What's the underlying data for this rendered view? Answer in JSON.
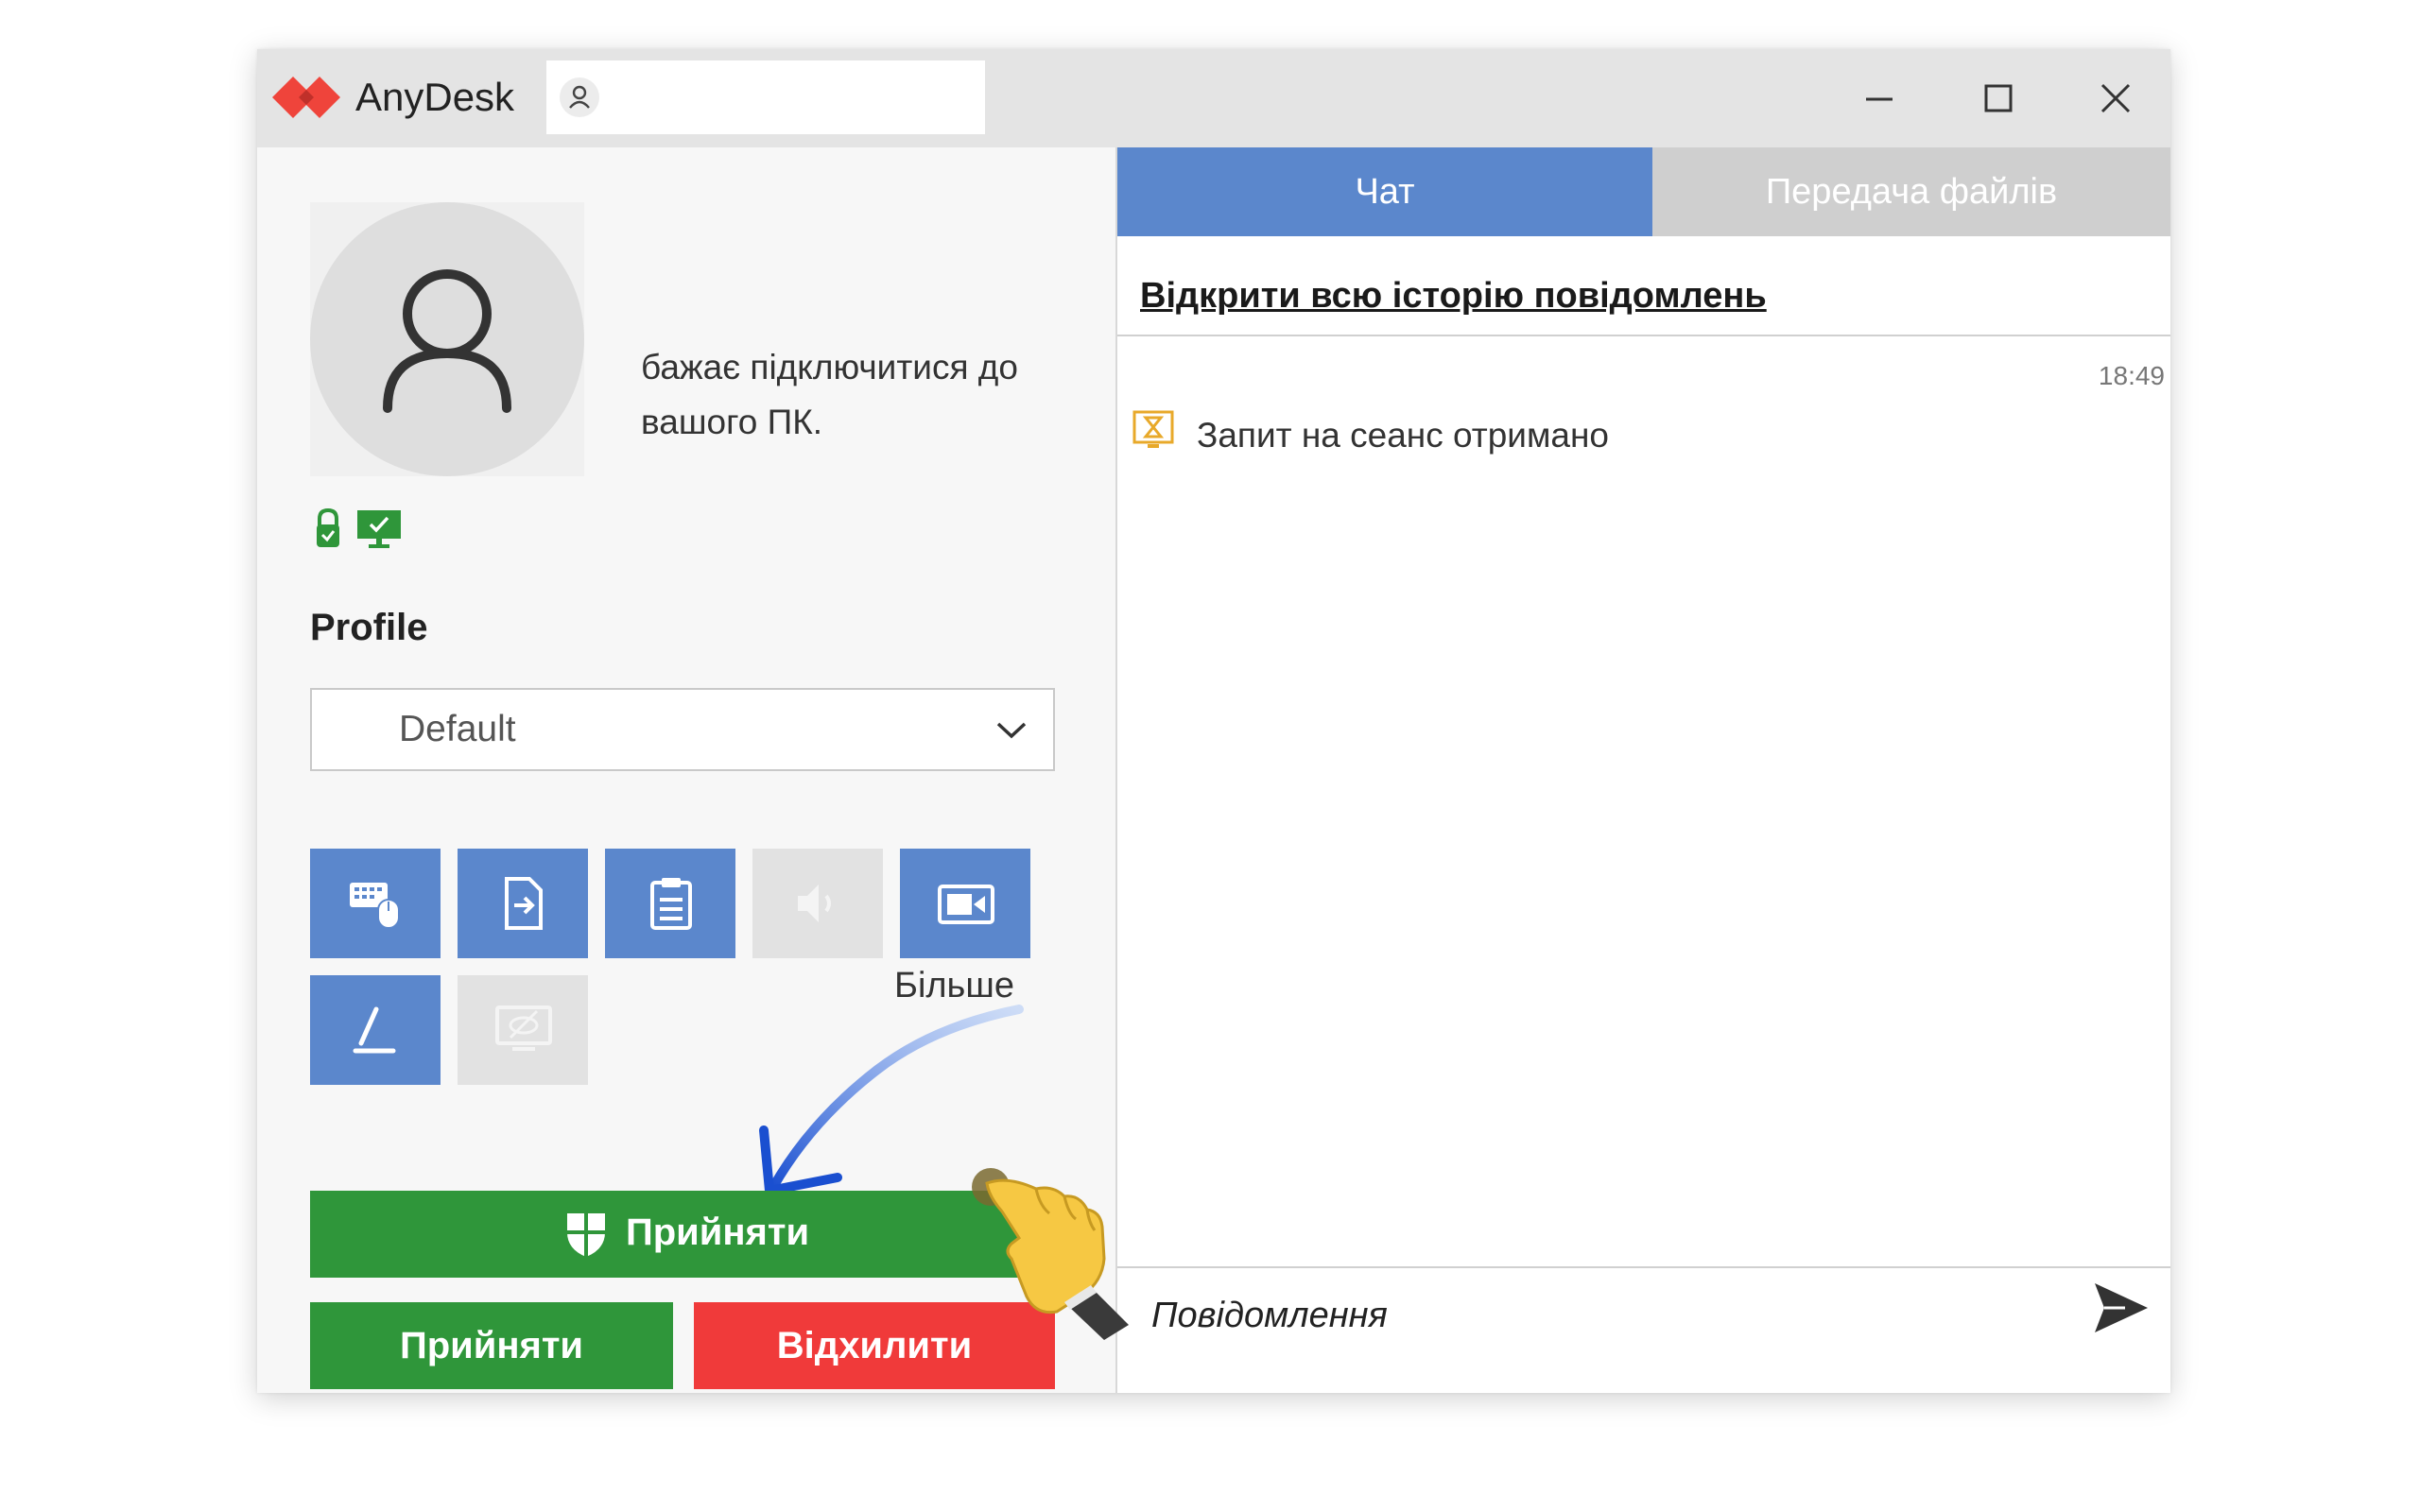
{
  "window": {
    "app_title": "AnyDesk",
    "address_input": {
      "value": "",
      "placeholder": ""
    },
    "controls": [
      "minimize-icon",
      "maximize-icon",
      "close-icon"
    ]
  },
  "request": {
    "text": "бажає підключитися до вашого ПК.",
    "status_icons": [
      "lock-icon",
      "monitor-check-icon"
    ]
  },
  "profile": {
    "label": "Profile",
    "selected": "Default"
  },
  "permissions": [
    {
      "icon": "keyboard-mouse-icon",
      "enabled": true
    },
    {
      "icon": "file-transfer-icon",
      "enabled": true
    },
    {
      "icon": "clipboard-icon",
      "enabled": true
    },
    {
      "icon": "audio-icon",
      "enabled": false
    },
    {
      "icon": "record-session-icon",
      "enabled": true
    },
    {
      "icon": "pen-draw-icon",
      "enabled": true
    },
    {
      "icon": "privacy-mode-icon",
      "enabled": false
    }
  ],
  "more_label": "Більше",
  "buttons": {
    "accept_main": "Прийняти",
    "accept": "Прийняти",
    "reject": "Відхилити"
  },
  "tabs": {
    "chat": "Чат",
    "file_transfer": "Передача файлів",
    "active": "chat"
  },
  "chat": {
    "history_link": "Відкрити всю історію повідомлень",
    "messages": [
      {
        "time": "18:49",
        "icon": "hourglass-icon",
        "text": "Запит на сеанс отримано"
      }
    ],
    "input_placeholder": "Повідомлення"
  },
  "colors": {
    "accent_blue": "#5b87cc",
    "accept_green": "#2f963a",
    "reject_red": "#f03a3a",
    "logo_red": "#ef443b"
  }
}
